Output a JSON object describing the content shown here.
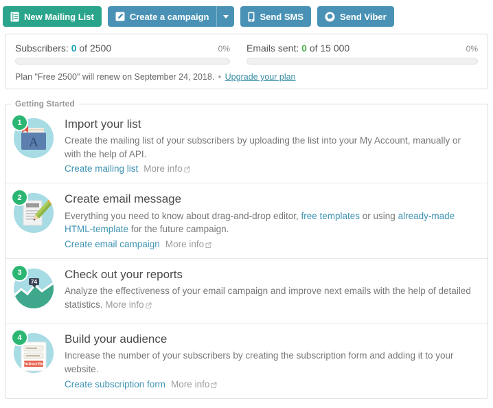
{
  "toolbar": {
    "new_mailing_list": {
      "label": "New Mailing List",
      "icon": "list-document-icon",
      "color": "#2aa58c"
    },
    "create_campaign": {
      "label": "Create a campaign",
      "icon": "compose-edit-icon",
      "color": "#4a92b5"
    },
    "campaign_dropdown": {
      "icon": "chevron-down-icon"
    },
    "send_sms": {
      "label": "Send SMS",
      "icon": "mobile-phone-icon",
      "color": "#4a92b5"
    },
    "send_viber": {
      "label": "Send Viber",
      "icon": "viber-icon",
      "color": "#4a92b5"
    }
  },
  "stats": {
    "subscribers": {
      "label": "Subscribers:",
      "value": "0",
      "of": "of 2500",
      "percent": "0%",
      "progress": 0,
      "value_color": "#18a0b8"
    },
    "emails_sent": {
      "label": "Emails sent:",
      "value": "0",
      "of": "of 15 000",
      "percent": "0%",
      "progress": 0,
      "value_color": "#4cb050"
    },
    "plan_text": "Plan \"Free 2500\" will renew on September 24, 2018.",
    "plan_separator": "•",
    "upgrade_link": "Upgrade your plan"
  },
  "getting_started": {
    "legend": "Getting Started",
    "items": [
      {
        "number": "1",
        "icon": "dictionary-book-icon",
        "title": "Import your list",
        "desc_parts": [
          {
            "text": "Create the mailing list of your subscribers by uploading the list into your My Account, manually or with the help of API.",
            "link": false
          }
        ],
        "primary_link": "Create mailing list",
        "more_info": "More info"
      },
      {
        "number": "2",
        "icon": "document-pencil-icon",
        "title": "Create email message",
        "desc_parts": [
          {
            "text": "Everything you need to know about drag-and-drop editor, ",
            "link": false
          },
          {
            "text": "free templates",
            "link": true
          },
          {
            "text": " or using ",
            "link": false
          },
          {
            "text": "already-made HTML-template",
            "link": true
          },
          {
            "text": " for the future campaign.",
            "link": false
          }
        ],
        "primary_link": "Create email campaign",
        "more_info": "More info"
      },
      {
        "number": "3",
        "icon": "area-chart-report-icon",
        "icon_label": "74",
        "title": "Check out your reports",
        "desc_parts": [
          {
            "text": "Analyze the effectiveness of your email campaign and improve next emails with the help of detailed statistics. ",
            "link": false
          }
        ],
        "primary_link": "",
        "more_info": "More info"
      },
      {
        "number": "4",
        "icon": "subscription-form-icon",
        "icon_button_label": "Subscribe",
        "title": "Build your audience",
        "desc_parts": [
          {
            "text": "Increase the number of your subscribers by creating the subscription form and adding it to your website.",
            "link": false
          }
        ],
        "primary_link": "Create subscription form",
        "more_info": "More info"
      }
    ]
  },
  "colors": {
    "brand_green": "#2aa58c",
    "brand_blue": "#4a92b5",
    "badge_green": "#2bb673",
    "icon_circle": "#a8dce4",
    "link": "#3f93b3",
    "muted": "#9a9a9a"
  }
}
